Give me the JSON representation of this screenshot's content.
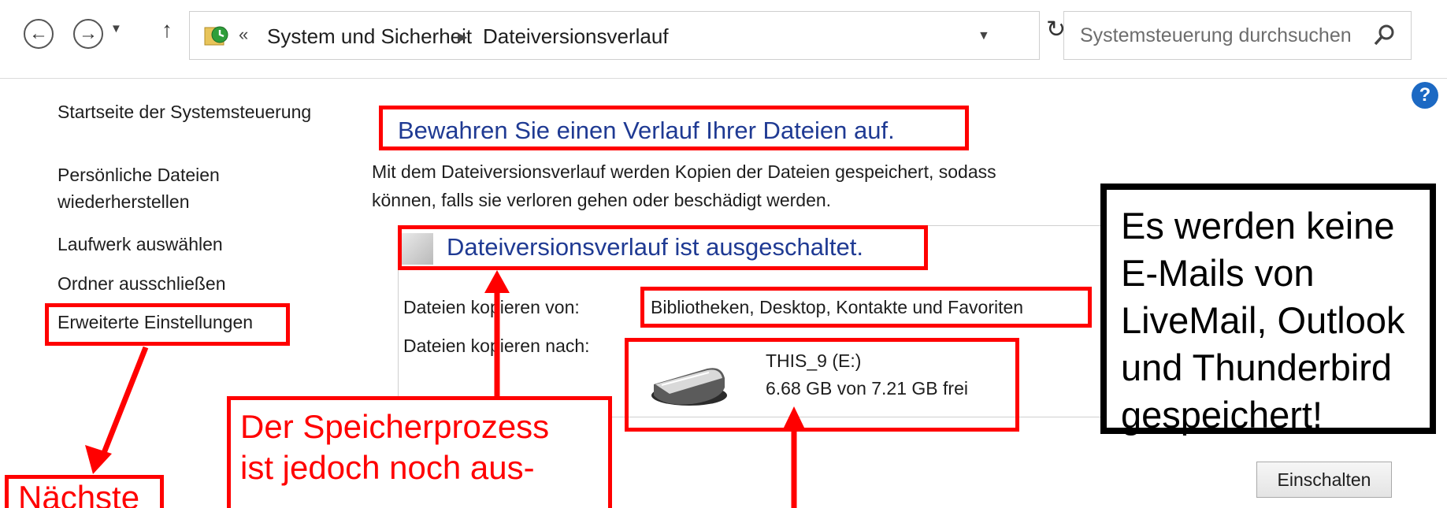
{
  "address_bar": {
    "back_icon": "arrow-left-icon",
    "forward_icon": "arrow-right-icon",
    "up_icon": "arrow-up-icon",
    "breadcrumb_separator": "«",
    "crumbs": [
      "System und Sicherheit",
      "Dateiversionsverlauf"
    ],
    "search_placeholder": "Systemsteuerung durchsuchen"
  },
  "sidebar": {
    "items": [
      {
        "label": "Startseite der Systemsteuerung"
      },
      {
        "label": "Persönliche Dateien"
      },
      {
        "label": "wiederherstellen"
      },
      {
        "label": "Laufwerk auswählen"
      },
      {
        "label": "Ordner ausschließen"
      },
      {
        "label": "Erweiterte Einstellungen"
      }
    ]
  },
  "main": {
    "heading": "Bewahren Sie einen Verlauf Ihrer Dateien auf.",
    "description_line1": "Mit dem Dateiversionsverlauf werden Kopien der Dateien gespeichert, sodass",
    "description_line2": "können, falls sie verloren gehen oder beschädigt werden.",
    "status": "Dateiversionsverlauf ist ausgeschaltet.",
    "copy_from_label": "Dateien kopieren von:",
    "copy_from_value": "Bibliotheken, Desktop, Kontakte und Favoriten",
    "copy_to_label": "Dateien kopieren nach:",
    "drive_name": "THIS_9 (E:)",
    "drive_free": "6.68 GB von 7.21 GB frei",
    "enable_button": "Einschalten"
  },
  "annotations": {
    "next_label": "Nächste",
    "callout_line1": "Der Speicherprozess",
    "callout_line2": "ist jedoch noch aus-",
    "note_lines": [
      "Es werden keine",
      "E-Mails von",
      "LiveMail, Outlook",
      "und Thunderbird",
      "gespeichert!"
    ]
  },
  "colors": {
    "annotation_red": "#ff0000",
    "heading_blue": "#1f3a93",
    "help_blue": "#1c69c3"
  }
}
